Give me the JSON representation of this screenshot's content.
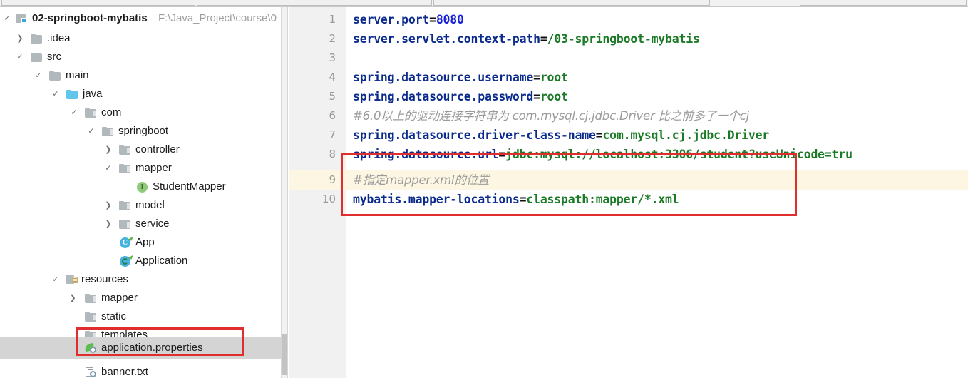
{
  "window": {
    "title": "02-springboot-mybatis",
    "project_path": "F:\\Java_Project\\course\\0"
  },
  "project_tree": {
    "root": {
      "label": "02-springboot-mybatis",
      "path_hint": "F:\\Java_Project\\course\\0",
      "icon": "module-icon",
      "expanded": true
    },
    "nodes": [
      {
        "label": ".idea",
        "icon": "folder-icon",
        "depth": 1,
        "state": "collapsed"
      },
      {
        "label": "src",
        "icon": "folder-icon",
        "depth": 1,
        "state": "expanded"
      },
      {
        "label": "main",
        "icon": "folder-icon",
        "depth": 2,
        "state": "expanded"
      },
      {
        "label": "java",
        "icon": "source-folder-icon",
        "depth": 3,
        "state": "expanded"
      },
      {
        "label": "com",
        "icon": "package-icon",
        "depth": 4,
        "state": "expanded"
      },
      {
        "label": "springboot",
        "icon": "package-icon",
        "depth": 5,
        "state": "expanded"
      },
      {
        "label": "controller",
        "icon": "package-icon",
        "depth": 6,
        "state": "collapsed"
      },
      {
        "label": "mapper",
        "icon": "package-icon",
        "depth": 6,
        "state": "expanded"
      },
      {
        "label": "StudentMapper",
        "icon": "interface-icon",
        "depth": 7,
        "state": "leaf"
      },
      {
        "label": "model",
        "icon": "package-icon",
        "depth": 6,
        "state": "collapsed"
      },
      {
        "label": "service",
        "icon": "package-icon",
        "depth": 6,
        "state": "collapsed"
      },
      {
        "label": "App",
        "icon": "class-icon",
        "depth": 6,
        "state": "leaf"
      },
      {
        "label": "Application",
        "icon": "spring-class-icon",
        "depth": 6,
        "state": "leaf"
      },
      {
        "label": "resources",
        "icon": "resources-folder-icon",
        "depth": 3,
        "state": "expanded"
      },
      {
        "label": "mapper",
        "icon": "package-icon",
        "depth": 4,
        "state": "collapsed"
      },
      {
        "label": "static",
        "icon": "package-icon",
        "depth": 4,
        "state": "leaf"
      },
      {
        "label": "templates",
        "icon": "package-icon",
        "depth": 4,
        "state": "leaf"
      },
      {
        "label": "application.properties",
        "icon": "spring-properties-icon",
        "depth": 4,
        "state": "leaf",
        "selected": true
      },
      {
        "label": "banner.txt",
        "icon": "text-file-icon",
        "depth": 4,
        "state": "leaf"
      }
    ]
  },
  "editor": {
    "line_numbers": [
      "1",
      "2",
      "3",
      "4",
      "5",
      "6",
      "7",
      "8",
      "9",
      "10"
    ],
    "highlighted_line": "9",
    "lines": [
      {
        "num": "1",
        "tokens": [
          {
            "t": "server.port",
            "c": "k"
          },
          {
            "t": "=",
            "c": "eq"
          },
          {
            "t": "8080",
            "c": "n"
          }
        ]
      },
      {
        "num": "2",
        "tokens": [
          {
            "t": "server.servlet.context-path",
            "c": "k"
          },
          {
            "t": "=",
            "c": "eq"
          },
          {
            "t": "/03-springboot-mybatis",
            "c": "v"
          }
        ]
      },
      {
        "num": "3",
        "tokens": []
      },
      {
        "num": "4",
        "tokens": [
          {
            "t": "spring.datasource.username",
            "c": "k"
          },
          {
            "t": "=",
            "c": "eq"
          },
          {
            "t": "root",
            "c": "v"
          }
        ]
      },
      {
        "num": "5",
        "tokens": [
          {
            "t": "spring.datasource.password",
            "c": "k"
          },
          {
            "t": "=",
            "c": "eq"
          },
          {
            "t": "root",
            "c": "v"
          }
        ]
      },
      {
        "num": "6",
        "tokens": [
          {
            "t": "#6.0以上的驱动连接字符串为 com.mysql.cj.jdbc.Driver   比之前多了一个cj",
            "c": "cm"
          }
        ]
      },
      {
        "num": "7",
        "tokens": [
          {
            "t": "spring.datasource.driver-class-name",
            "c": "k"
          },
          {
            "t": "=",
            "c": "eq"
          },
          {
            "t": "com.mysql.cj.jdbc.Driver",
            "c": "v"
          }
        ]
      },
      {
        "num": "8",
        "tokens": [
          {
            "t": "spring.datasource.url",
            "c": "k"
          },
          {
            "t": "=",
            "c": "eq"
          },
          {
            "t": "jdbc:mysql://localhost:3306/student?useUnicode=tru",
            "c": "v"
          }
        ]
      },
      {
        "num": "9",
        "tokens": [
          {
            "t": "#指定mapper.xml的位置",
            "c": "cm"
          }
        ]
      },
      {
        "num": "10",
        "tokens": [
          {
            "t": "mybatis.mapper-locations",
            "c": "k"
          },
          {
            "t": "=",
            "c": "eq"
          },
          {
            "t": "classpath:mapper/*.xml",
            "c": "v"
          }
        ]
      }
    ]
  },
  "annotations": {
    "code_highlight_box": {
      "color": "#e02d2d",
      "target_lines": "9-10"
    },
    "tree_highlight_box": {
      "color": "#e02d2d",
      "target": "application.properties"
    }
  },
  "colors": {
    "key": "#0a2a8c",
    "value": "#1a7a25",
    "number": "#1720d6",
    "comment": "#9b9b9b",
    "current_line": "#fcf6e3",
    "selection": "#d4d4d4",
    "annotation": "#e02d2d"
  }
}
